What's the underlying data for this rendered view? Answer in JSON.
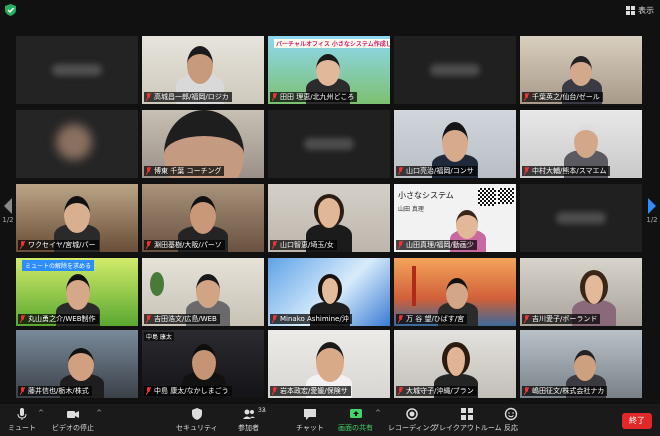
{
  "top": {
    "view_label": "表示"
  },
  "pages": {
    "left": "1/2",
    "right": "1/2"
  },
  "participants": [
    {
      "name": "",
      "blurred": true
    },
    {
      "name": "高城昌一郎/福岡/ロジカ",
      "active": true
    },
    {
      "name": "田田 理恵/北九州どころ",
      "banner": "バーチャルオフィス 小さなシステム作成して！"
    },
    {
      "name": "",
      "blurred": true
    },
    {
      "name": "千葉英之/仙台/ゼール"
    },
    {
      "name": "",
      "blurred": true
    },
    {
      "name": "博東 千葉 コーチング"
    },
    {
      "name": "",
      "blurred": true
    },
    {
      "name": "山口亮治/福岡/コンサ"
    },
    {
      "name": "中村大輔/熊本/スマエム"
    },
    {
      "name": "ワクセイヤ/宮城/パー"
    },
    {
      "name": "淵田基樹/大阪/パーソ"
    },
    {
      "name": "山口智恵/埼玉/女"
    },
    {
      "name": "山田真理/福岡/動画少",
      "slide_title": "小さなシステム",
      "slide_sub": "山田 真理"
    },
    {
      "name": "",
      "blurred": true
    },
    {
      "name": "丸山勇之介/WEB制作",
      "chip": "ミュートの解除を求める"
    },
    {
      "name": "吉田浩文/広島/WEB"
    },
    {
      "name": "Minako Ashimine/沖"
    },
    {
      "name": "万 谷 望/ひばす/宮"
    },
    {
      "name": "吉川愛子/ポーランド"
    },
    {
      "name": "藤井信也/栃木/株式"
    },
    {
      "name": "中島 康太/なかしまごう",
      "chip": "中島 康太"
    },
    {
      "name": "岩本政宏/愛媛/保険サ"
    },
    {
      "name": "大城守子/沖縄/ブラン"
    },
    {
      "name": "嶋田征文/株式会社ナカ"
    }
  ],
  "toolbar": {
    "mute": "ミュート",
    "video": "ビデオの停止",
    "security": "セキュリティ",
    "participants": "参加者",
    "participants_count": "33",
    "chat": "チャット",
    "share": "画面の共有",
    "record": "レコーディング",
    "breakout": "ブレイクアウトルーム",
    "reactions": "反応",
    "end": "終了"
  },
  "colors": {
    "accent": "#2d8cff",
    "active_border": "#c4d62a",
    "share_green": "#44d26a",
    "end_red": "#e02828"
  }
}
